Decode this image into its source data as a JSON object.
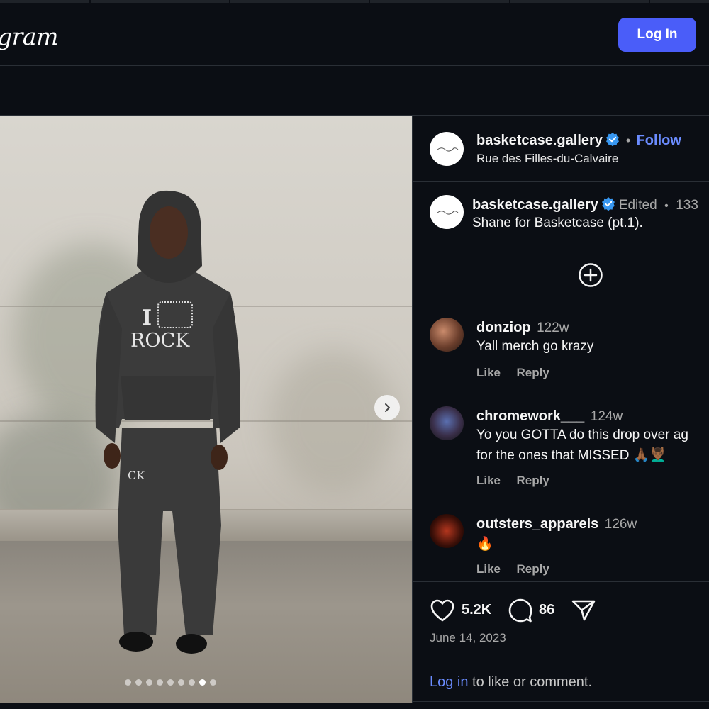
{
  "header": {
    "logo_text": "Instagram",
    "visible_logo": "gram",
    "login_label": "Log In"
  },
  "carousel": {
    "slide_count": 9,
    "active_index": 7
  },
  "post": {
    "author": "basketcase.gallery",
    "location": "Rue des Filles-du-Calvaire",
    "follow_label": "Follow",
    "separator": "•",
    "caption_author": "basketcase.gallery",
    "edited_label": "Edited",
    "caption_time": "133",
    "caption_text": "Shane for Basketcase (pt.1)."
  },
  "comments": [
    {
      "user": "donziop",
      "time": "122w",
      "text": "Yall merch go krazy",
      "like": "Like",
      "reply": "Reply"
    },
    {
      "user": "chromework___",
      "time": "124w",
      "text_line1": "Yo you GOTTA do this drop over ag",
      "text_line2": "for the ones that MISSED 🙏🏾💆🏾‍♂️",
      "like": "Like",
      "reply": "Reply"
    },
    {
      "user": "outsters_apparels",
      "time": "126w",
      "text": "🔥",
      "like": "Like",
      "reply": "Reply"
    }
  ],
  "stats": {
    "likes": "5.2K",
    "comments": "86",
    "date": "June 14, 2023"
  },
  "footer": {
    "login_link": "Log in",
    "rest": " to like or comment."
  },
  "colors": {
    "background": "#0b0e14",
    "accent_button": "#4a5df9",
    "link": "#6b8cff",
    "verified": "#3897f0"
  },
  "icons": [
    "verified-icon",
    "add-circle-icon",
    "heart-icon",
    "comment-icon",
    "share-icon",
    "chevron-right-icon"
  ]
}
